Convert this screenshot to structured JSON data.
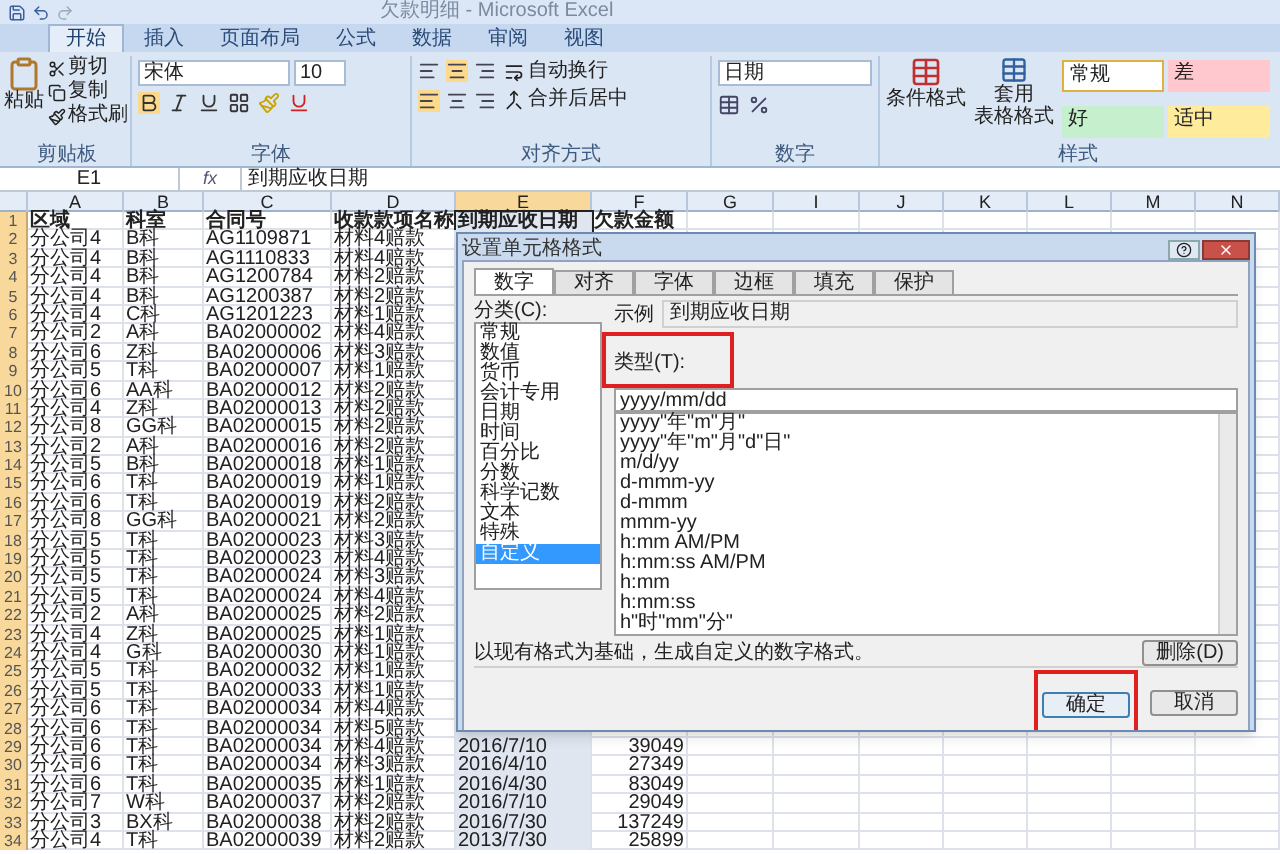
{
  "window": {
    "title": "欠款明细 - Microsoft Excel"
  },
  "ribbon_tabs": [
    {
      "label": "开始",
      "selected": true
    },
    {
      "label": "插入",
      "selected": false
    },
    {
      "label": "页面布局",
      "selected": false
    },
    {
      "label": "公式",
      "selected": false
    },
    {
      "label": "数据",
      "selected": false
    },
    {
      "label": "审阅",
      "selected": false
    },
    {
      "label": "视图",
      "selected": false
    }
  ],
  "ribbon": {
    "clipboard": {
      "paste": "粘贴",
      "cut": "剪切",
      "copy": "复制",
      "format_painter": "格式刷",
      "group": "剪贴板"
    },
    "font": {
      "name": "宋体",
      "size": "10",
      "group": "字体"
    },
    "alignment": {
      "wrap": "自动换行",
      "merge": "合并后居中",
      "group": "对齐方式"
    },
    "number": {
      "format": "日期",
      "group": "数字"
    },
    "styles": {
      "conditional": "条件格式",
      "table_lines": [
        "套用",
        "表格格式"
      ],
      "cells": [
        {
          "label": "常规",
          "color": "#ffffff"
        },
        {
          "label": "差",
          "color": "#ffc7ce"
        },
        {
          "label": "好",
          "color": "#c6efce"
        },
        {
          "label": "适中",
          "color": "#ffeb9c"
        }
      ],
      "group": "样式"
    }
  },
  "formula_bar": {
    "cell": "E1",
    "fx": "fx",
    "value": "到期应收日期"
  },
  "sheet": {
    "columns": [
      {
        "label": "A",
        "selected": false
      },
      {
        "label": "B",
        "selected": false
      },
      {
        "label": "C",
        "selected": false
      },
      {
        "label": "D",
        "selected": false
      },
      {
        "label": "E",
        "selected": true
      },
      {
        "label": "F",
        "selected": false
      },
      {
        "label": "G",
        "selected": false
      },
      {
        "label": "I",
        "selected": false
      },
      {
        "label": "J",
        "selected": false
      },
      {
        "label": "K",
        "selected": false
      },
      {
        "label": "L",
        "selected": false
      },
      {
        "label": "M",
        "selected": false
      },
      {
        "label": "N",
        "selected": false
      }
    ],
    "rows": [
      {
        "number": "1",
        "cells": [
          "区域",
          "科室",
          "合同号",
          "收款款项名称",
          "到期应收日期",
          "欠款金额"
        ]
      },
      {
        "number": "2",
        "cells": [
          "分公司4",
          "B科",
          "AG1109871",
          "材料4赔款"
        ]
      },
      {
        "number": "3",
        "cells": [
          "分公司4",
          "B科",
          "AG1110833",
          "材料4赔款"
        ]
      },
      {
        "number": "4",
        "cells": [
          "分公司4",
          "B科",
          "AG1200784",
          "材料2赔款"
        ]
      },
      {
        "number": "5",
        "cells": [
          "分公司4",
          "B科",
          "AG1200387",
          "材料2赔款"
        ]
      },
      {
        "number": "6",
        "cells": [
          "分公司4",
          "C科",
          "AG1201223",
          "材料1赔款"
        ]
      },
      {
        "number": "7",
        "cells": [
          "分公司2",
          "A科",
          "BA02000002",
          "材料4赔款"
        ]
      },
      {
        "number": "8",
        "cells": [
          "分公司6",
          "Z科",
          "BA02000006",
          "材料3赔款"
        ]
      },
      {
        "number": "9",
        "cells": [
          "分公司5",
          "T科",
          "BA02000007",
          "材料1赔款"
        ]
      },
      {
        "number": "10",
        "cells": [
          "分公司6",
          "AA科",
          "BA02000012",
          "材料2赔款"
        ]
      },
      {
        "number": "11",
        "cells": [
          "分公司4",
          "Z科",
          "BA02000013",
          "材料2赔款"
        ]
      },
      {
        "number": "12",
        "cells": [
          "分公司8",
          "GG科",
          "BA02000015",
          "材料2赔款"
        ]
      },
      {
        "number": "13",
        "cells": [
          "分公司2",
          "A科",
          "BA02000016",
          "材料2赔款"
        ]
      },
      {
        "number": "14",
        "cells": [
          "分公司5",
          "B科",
          "BA02000018",
          "材料1赔款"
        ]
      },
      {
        "number": "15",
        "cells": [
          "分公司6",
          "T科",
          "BA02000019",
          "材料1赔款"
        ]
      },
      {
        "number": "16",
        "cells": [
          "分公司6",
          "T科",
          "BA02000019",
          "材料2赔款"
        ]
      },
      {
        "number": "17",
        "cells": [
          "分公司8",
          "GG科",
          "BA02000021",
          "材料2赔款"
        ]
      },
      {
        "number": "18",
        "cells": [
          "分公司5",
          "T科",
          "BA02000023",
          "材料3赔款"
        ]
      },
      {
        "number": "19",
        "cells": [
          "分公司5",
          "T科",
          "BA02000023",
          "材料4赔款"
        ]
      },
      {
        "number": "20",
        "cells": [
          "分公司5",
          "T科",
          "BA02000024",
          "材料3赔款"
        ]
      },
      {
        "number": "21",
        "cells": [
          "分公司5",
          "T科",
          "BA02000024",
          "材料4赔款"
        ]
      },
      {
        "number": "22",
        "cells": [
          "分公司2",
          "A科",
          "BA02000025",
          "材料2赔款"
        ]
      },
      {
        "number": "23",
        "cells": [
          "分公司4",
          "Z科",
          "BA02000025",
          "材料1赔款"
        ]
      },
      {
        "number": "24",
        "cells": [
          "分公司4",
          "G科",
          "BA02000030",
          "材料1赔款"
        ]
      },
      {
        "number": "25",
        "cells": [
          "分公司5",
          "T科",
          "BA02000032",
          "材料1赔款"
        ]
      },
      {
        "number": "26",
        "cells": [
          "分公司5",
          "T科",
          "BA02000033",
          "材料1赔款"
        ]
      },
      {
        "number": "27",
        "cells": [
          "分公司6",
          "T科",
          "BA02000034",
          "材料4赔款"
        ]
      },
      {
        "number": "28",
        "cells": [
          "分公司6",
          "T科",
          "BA02000034",
          "材料5赔款"
        ]
      },
      {
        "number": "29",
        "cells": [
          "分公司6",
          "T科",
          "BA02000034",
          "材料4赔款",
          "2016/7/10",
          "39049"
        ]
      },
      {
        "number": "30",
        "cells": [
          "分公司6",
          "T科",
          "BA02000034",
          "材料3赔款",
          "2016/4/10",
          "27349"
        ]
      },
      {
        "number": "31",
        "cells": [
          "分公司6",
          "T科",
          "BA02000035",
          "材料1赔款",
          "2016/4/30",
          "83049"
        ]
      },
      {
        "number": "32",
        "cells": [
          "分公司7",
          "W科",
          "BA02000037",
          "材料2赔款",
          "2016/7/10",
          "29049"
        ]
      },
      {
        "number": "33",
        "cells": [
          "分公司3",
          "BX科",
          "BA02000038",
          "材料2赔款",
          "2016/7/30",
          "137249"
        ]
      },
      {
        "number": "34",
        "cells": [
          "分公司4",
          "T科",
          "BA02000039",
          "材料2赔款",
          "2013/7/30",
          "25899"
        ]
      }
    ]
  },
  "dialog": {
    "title": "设置单元格格式",
    "tabs": [
      {
        "label": "数字",
        "selected": true
      },
      {
        "label": "对齐",
        "selected": false
      },
      {
        "label": "字体",
        "selected": false
      },
      {
        "label": "边框",
        "selected": false
      },
      {
        "label": "填充",
        "selected": false
      },
      {
        "label": "保护",
        "selected": false
      }
    ],
    "category_label": "分类(C):",
    "categories": [
      {
        "label": "常规",
        "selected": false
      },
      {
        "label": "数值",
        "selected": false
      },
      {
        "label": "货币",
        "selected": false
      },
      {
        "label": "会计专用",
        "selected": false
      },
      {
        "label": "日期",
        "selected": false
      },
      {
        "label": "时间",
        "selected": false
      },
      {
        "label": "百分比",
        "selected": false
      },
      {
        "label": "分数",
        "selected": false
      },
      {
        "label": "科学记数",
        "selected": false
      },
      {
        "label": "文本",
        "selected": false
      },
      {
        "label": "特殊",
        "selected": false
      },
      {
        "label": "自定义",
        "selected": true
      }
    ],
    "sample_label": "示例",
    "sample_value": "到期应收日期",
    "type_label": "类型(T):",
    "type_value": "yyyy/mm/dd",
    "formats": [
      "yyyy\"年\"m\"月\"",
      "yyyy\"年\"m\"月\"d\"日\"",
      "m/d/yy",
      "d-mmm-yy",
      "d-mmm",
      "mmm-yy",
      "h:mm AM/PM",
      "h:mm:ss AM/PM",
      "h:mm",
      "h:mm:ss",
      "h\"时\"mm\"分\""
    ],
    "delete_button": "删除(D)",
    "description": "以现有格式为基础，生成自定义的数字格式。",
    "ok_button": "确定",
    "cancel_button": "取消"
  }
}
